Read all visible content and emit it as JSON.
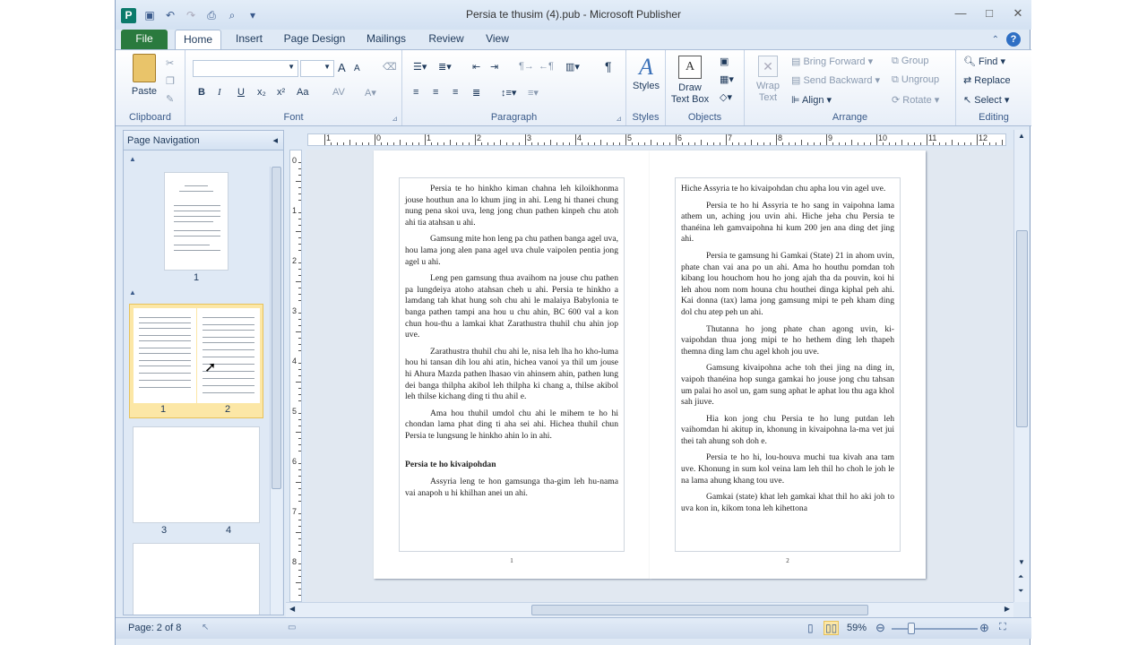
{
  "window": {
    "title": "Persia  te thusim (4).pub - Microsoft Publisher",
    "app_icon": "P",
    "controls": {
      "minimize": "—",
      "maximize": "□",
      "close": "✕"
    }
  },
  "ribbon_tabs": [
    "File",
    "Home",
    "Insert",
    "Page Design",
    "Mailings",
    "Review",
    "View"
  ],
  "ribbon": {
    "clipboard": {
      "label": "Clipboard",
      "paste": "Paste"
    },
    "font": {
      "label": "Font",
      "bold": "B",
      "italic": "I",
      "underline": "U",
      "subscript": "x₂",
      "superscript": "x²",
      "case": "Aa",
      "grow": "A",
      "shrink": "A"
    },
    "paragraph": {
      "label": "Paragraph",
      "pilcrow": "¶"
    },
    "styles": {
      "label": "Styles",
      "button": "Styles"
    },
    "objects": {
      "label": "Objects",
      "draw_text_box": "Draw Text Box"
    },
    "arrange": {
      "label": "Arrange",
      "wrap_text": "Wrap Text",
      "bring_forward": "Bring Forward",
      "send_backward": "Send Backward",
      "align": "Align",
      "group": "Group",
      "ungroup": "Ungroup",
      "rotate": "Rotate"
    },
    "editing": {
      "label": "Editing",
      "find": "Find",
      "replace": "Replace",
      "select": "Select"
    }
  },
  "page_navigation": {
    "title": "Page Navigation",
    "pages": [
      {
        "labels": [
          "1"
        ]
      },
      {
        "labels": [
          "1",
          "2"
        ],
        "selected": true
      },
      {
        "labels": [
          "3",
          "4"
        ]
      },
      {
        "labels": []
      }
    ]
  },
  "rulers": {
    "horizontal": [
      "1",
      "0",
      "1",
      "2",
      "3",
      "4",
      "5",
      "6",
      "7",
      "8",
      "9",
      "10",
      "11",
      "12"
    ],
    "vertical": [
      "0",
      "1",
      "2",
      "3",
      "4",
      "5",
      "6",
      "7",
      "8"
    ]
  },
  "document": {
    "left_page": {
      "number": "1",
      "paragraphs": [
        "Persia te ho hinkho kiman chahna leh kiloikhonma jouse houthun ana lo khum jing in ahi. Leng hi thanei chung nung pena skoi uva, leng jong chun pathen kinpeh chu atoh ahi tia atahsan u ahi.",
        "Gamsung mite hon leng pa chu pathen banga agel uva, hou lama jong alen pana agel uva chule vaipolen pentia jong agel u ahi.",
        "Leng pen gamsung thua avaihom na jouse chu pathen pa lungdeiya atoho atahsan cheh u ahi. Persia te hinkho a lamdang tah khat hung soh chu ahi le malaiya Babylonia te banga pathen tampi ana hou u chu ahin, BC 600 val a kon chun hou-thu a lamkai khat Zarathustra thuhil chu ahin jop uve.",
        "Zarathustra thuhil chu ahi le, nisa leh lha ho kho-luma hou hi tansan dih lou ahi atin, hichea vanoi ya thil um jouse hi Ahura Mazda pathen lhasao vin ahinsem ahin, pathen lung dei banga thilpha akibol leh thilpha ki chang a, thilse akibol leh thilse kichang ding ti thu ahil e.",
        "Ama hou thuhil umdol chu ahi le mihem te ho hi chondan lama phat ding ti aha sei ahi. Hichea thuhil chun Persia te lungsung le hinkho ahin lo in ahi."
      ],
      "heading": "Persia te ho kivaipohdan",
      "after_heading": "Assyria leng te hon gamsunga tha-gim leh hu-nama vai anapoh u hi khilhan anei un ahi."
    },
    "right_page": {
      "number": "2",
      "paragraphs": [
        "Hiche Assyria te ho kivaipohdan chu apha lou vin agel uve.",
        "Persia te ho hi Assyria te ho sang in vaipohna lama athem un, aching jou uvin ahi. Hiche jeha chu Persia te thanéina leh gamvaipohna hi kum 200 jen ana ding det jing ahi.",
        "Persia te gamsung hi Gamkai (State) 21 in ahom uvin, phate chan vai ana po un ahi. Ama ho houthu pomdan toh kibang lou houchom hou ho jong ajah tha da pouvin, koi hi leh ahou nom nom houna chu houthei dinga kiphal peh ahi. Kai donna (tax) lama jong gamsung mipi te peh kham ding dol chu atep peh un ahi.",
        "Thutanna ho jong phate chan agong uvin, ki-vaipohdan thua jong mipi te ho hethem ding leh thapeh themna ding lam chu agel khoh jou uve.",
        "Gamsung kivaipohna ache toh thei jing na ding in, vaipoh thanéina hop sunga gamkai ho jouse jong chu tahsan um palai ho asol un, gam sung aphat le aphat lou thu aga khol sah jiuve.",
        "Hia kon jong chu Persia te ho lung putdan leh vaihomdan hi akitup in, khonung in kivaipohna la-ma vet jui thei tah ahung soh doh e.",
        "Persia te ho hi, lou-houva muchi tua kivah ana tam uve. Khonung in sum kol veina lam leh thil ho choh le joh le na lama ahung khang tou uve.",
        "Gamkai (state) khat leh gamkai khat thil ho aki joh to uva kon in, kikom tona leh kihettona"
      ]
    }
  },
  "status_bar": {
    "page": "Page: 2 of 8",
    "zoom": "59%"
  },
  "colors": {
    "file_tab": "#2a7a3e",
    "ribbon_bg": "#dfe9f5",
    "selected_thumb": "#fce7a6",
    "spell_underline": "#d33"
  }
}
